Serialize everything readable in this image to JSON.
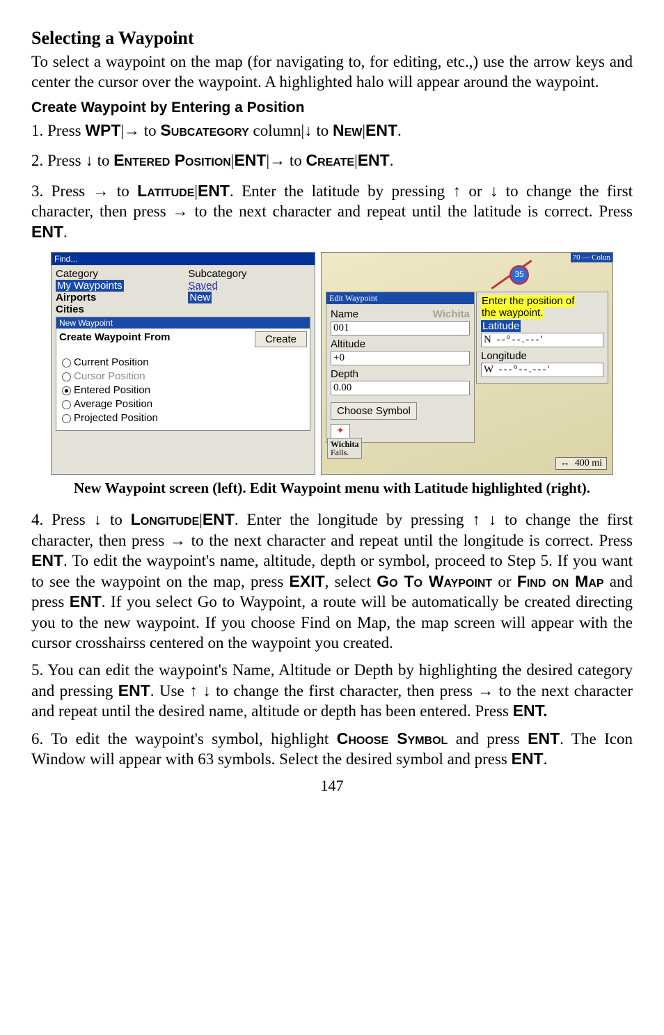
{
  "section_title": "Selecting a Waypoint",
  "intro_para": "To select a waypoint on the map (for navigating to, for editing, etc.,) use the arrow keys and center the cursor over the waypoint. A highlighted halo will appear around the waypoint.",
  "sub_heading": "Create Waypoint by Entering a Position",
  "step1": {
    "prefix": "1. Press ",
    "wpt": "WPT",
    "bar1": "|",
    "arr1": "→",
    "to1": " to ",
    "subcat": "Subcategory",
    "col": " column",
    "bar2": "|",
    "arr2": "↓",
    "to2": " to ",
    "new": "New",
    "bar3": "|",
    "ent": "ENT",
    "dot": "."
  },
  "step2": {
    "prefix": "2. Press ",
    "arr1": "↓",
    "to1": " to ",
    "ep": "Entered Position",
    "bar1": "|",
    "ent1": "ENT",
    "bar2": "|",
    "arr2": "→",
    "to2": " to ",
    "create": "Create",
    "bar3": "|",
    "ent2": "ENT",
    "dot": "."
  },
  "step3": {
    "prefix": "3. Press ",
    "arr1": "→",
    "to1": " to ",
    "lat": "Latitude",
    "bar": "|",
    "ent1": "ENT",
    "mid": ". Enter the latitude by pressing ",
    "up": "↑",
    "or": " or ",
    "down": "↓",
    "rest1": " to change the first character, then press ",
    "arr2": "→",
    "rest2": " to the next character and repeat until the latitude is correct. Press ",
    "ent2": "ENT",
    "dot": "."
  },
  "left_shot": {
    "titlebar": "Find...",
    "category": "Category",
    "subcategory": "Subcategory",
    "my_wpts": "My Waypoints",
    "saved": "Saved",
    "airports": "Airports",
    "new": "New",
    "cities": "Cities",
    "new_wpt_header": "New Waypoint",
    "cwf": "Create Waypoint From",
    "create_btn": "Create",
    "o_current": "Current Position",
    "o_cursor": "Cursor Position",
    "o_entered": "Entered Position",
    "o_average": "Average Position",
    "o_projected": "Projected Position"
  },
  "right_shot": {
    "colun": "70 — Colun",
    "shield": "35",
    "edit_title": "Edit Waypoint",
    "name_lbl": "Name",
    "name_ghost": "Wichita",
    "name_val": "001",
    "alt_lbl": "Altitude",
    "alt_val": "+0",
    "depth_lbl": "Depth",
    "depth_val": "0.00",
    "choose": "Choose Symbol",
    "sym": "✦",
    "tip1": "Enter the position of",
    "tip2": "the waypoint.",
    "lat_lbl": "Latitude",
    "lat_val": "N  --°--.---'",
    "lon_lbl": "Longitude",
    "lon_val": "W ---°--.---'",
    "wichita": "Wichita",
    "falls": "Falls.",
    "scale_arrow": "↔",
    "scale": "400 mi"
  },
  "caption": "New Waypoint screen (left). Edit Waypoint menu with Latitude highlighted (right).",
  "step4": {
    "prefix": "4. Press ",
    "down": "↓",
    "to1": " to ",
    "lon": "Longitude",
    "bar": "|",
    "ent1": "ENT",
    "mid": ". Enter the longitude by pressing ",
    "up": "↑",
    "down2": "↓",
    "rest1": " to change the first character, then press ",
    "arr": "→",
    "rest2": " to the next character and repeat until the longitude is correct. Press ",
    "ent2": "ENT",
    "rest3": ". To edit the waypoint's name, altitude, depth or symbol, proceed to Step 5. If you want to see the waypoint on the map, press ",
    "exit": "EXIT",
    "sel": ", select ",
    "goto": "Go To Waypoint",
    "or": " or ",
    "find": "Find on Map",
    "and": " and press ",
    "ent3": "ENT",
    "rest4": ". If you select Go to Waypoint, a route will be automatically be created directing you to the new waypoint. If you choose Find on Map, the map screen will appear with the cursor crosshairss centered on the waypoint you created."
  },
  "step5": {
    "text1": "5. You can edit the waypoint's Name, Altitude or Depth by highlighting the desired category and pressing ",
    "ent1": "ENT",
    "text2": ". Use ",
    "up": "↑",
    "down": "↓",
    "text3": " to change the first character, then press ",
    "arr": "→",
    "text4": " to the next character and repeat until the desired name, altitude or depth has been entered. Press ",
    "ent2": "ENT."
  },
  "step6": {
    "text1": "6. To edit the waypoint's symbol, highlight ",
    "choose": "Choose Symbol",
    "text2": " and press ",
    "ent1": "ENT",
    "text3": ". The Icon Window will appear with 63 symbols. Select the desired symbol and press ",
    "ent2": "ENT",
    "dot": "."
  },
  "page_number": "147"
}
